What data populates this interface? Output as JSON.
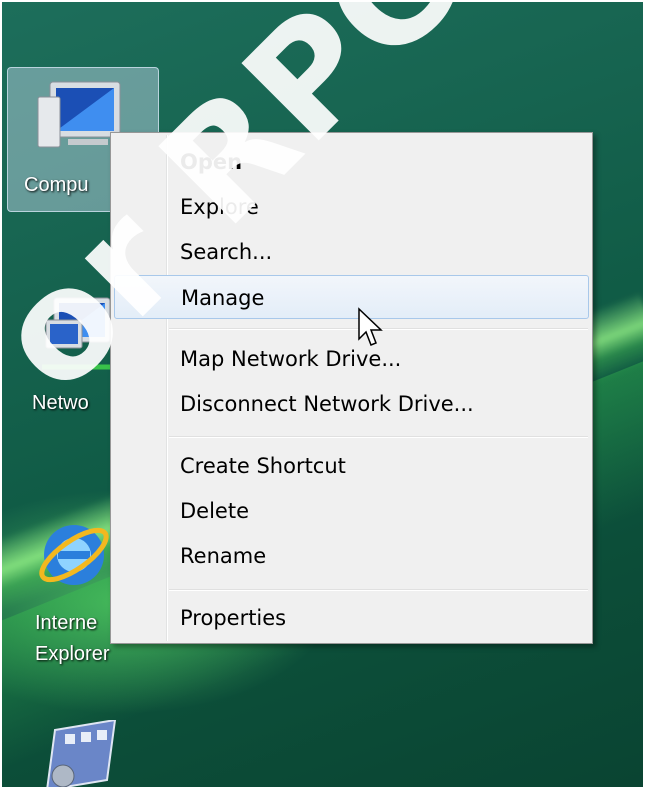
{
  "desktop": {
    "icons": [
      {
        "label": "Compu"
      },
      {
        "label": "Netwo"
      },
      {
        "label": "Interne",
        "label2": "Explorer"
      },
      {
        "label": ""
      }
    ]
  },
  "context_menu": {
    "items": [
      {
        "label": "Open"
      },
      {
        "label": "Explore"
      },
      {
        "label": "Search..."
      },
      {
        "label": "Manage"
      },
      {
        "label": "Map Network Drive..."
      },
      {
        "label": "Disconnect Network Drive..."
      },
      {
        "label": "Create Shortcut"
      },
      {
        "label": "Delete"
      },
      {
        "label": "Rename"
      },
      {
        "label": "Properties"
      }
    ]
  },
  "watermark": {
    "text": "or RPC serv"
  },
  "colors": {
    "desktop": "#146050",
    "menu_bg": "#f0f0f0",
    "hover_border": "#a8c8ea"
  }
}
